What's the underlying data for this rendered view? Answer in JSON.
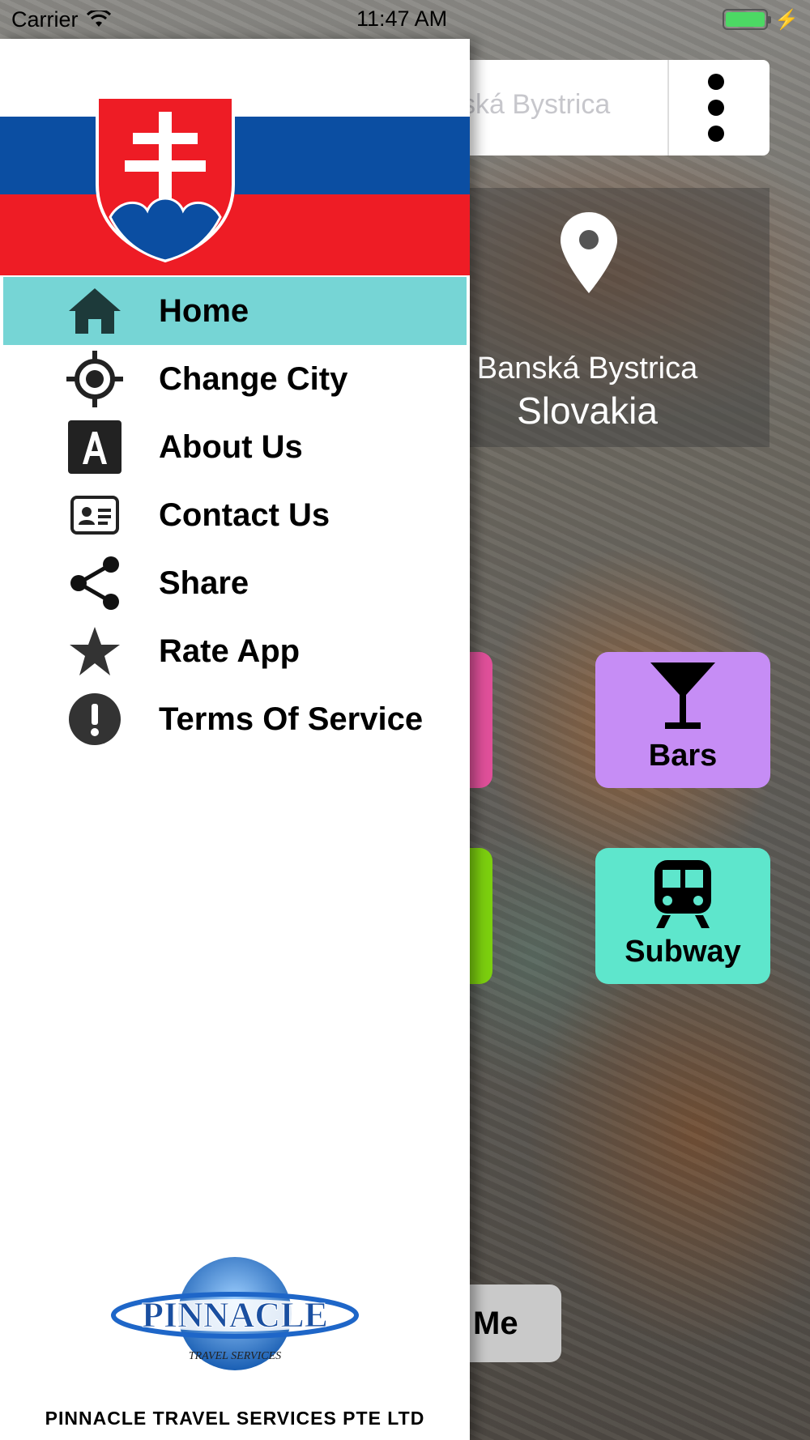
{
  "status_bar": {
    "carrier": "Carrier",
    "time": "11:47 AM"
  },
  "search": {
    "value": "ská Bystrica"
  },
  "location": {
    "city": "Banská Bystrica",
    "country": "Slovakia"
  },
  "tiles": {
    "bars_label": "Bars",
    "subway_label": "Subway"
  },
  "locate_button": {
    "label": "Me"
  },
  "drawer": {
    "items": [
      {
        "label": "Home",
        "icon": "home-icon",
        "active": true
      },
      {
        "label": "Change City",
        "icon": "crosshair-icon"
      },
      {
        "label": "About Us",
        "icon": "letter-a-icon"
      },
      {
        "label": "Contact Us",
        "icon": "contact-card-icon"
      },
      {
        "label": "Share",
        "icon": "share-icon"
      },
      {
        "label": "Rate App",
        "icon": "star-icon"
      },
      {
        "label": "Terms Of Service",
        "icon": "alert-icon"
      }
    ],
    "logo_text": "PINNACLE",
    "logo_subtext": "TRAVEL SERVICES",
    "company": "PINNACLE TRAVEL SERVICES PTE LTD"
  },
  "colors": {
    "active_item": "#76d5d5",
    "bars_tile": "#c68df5",
    "subway_tile": "#5ee6cc",
    "flag_blue": "#0b4ea2",
    "flag_red": "#ee1c25"
  }
}
